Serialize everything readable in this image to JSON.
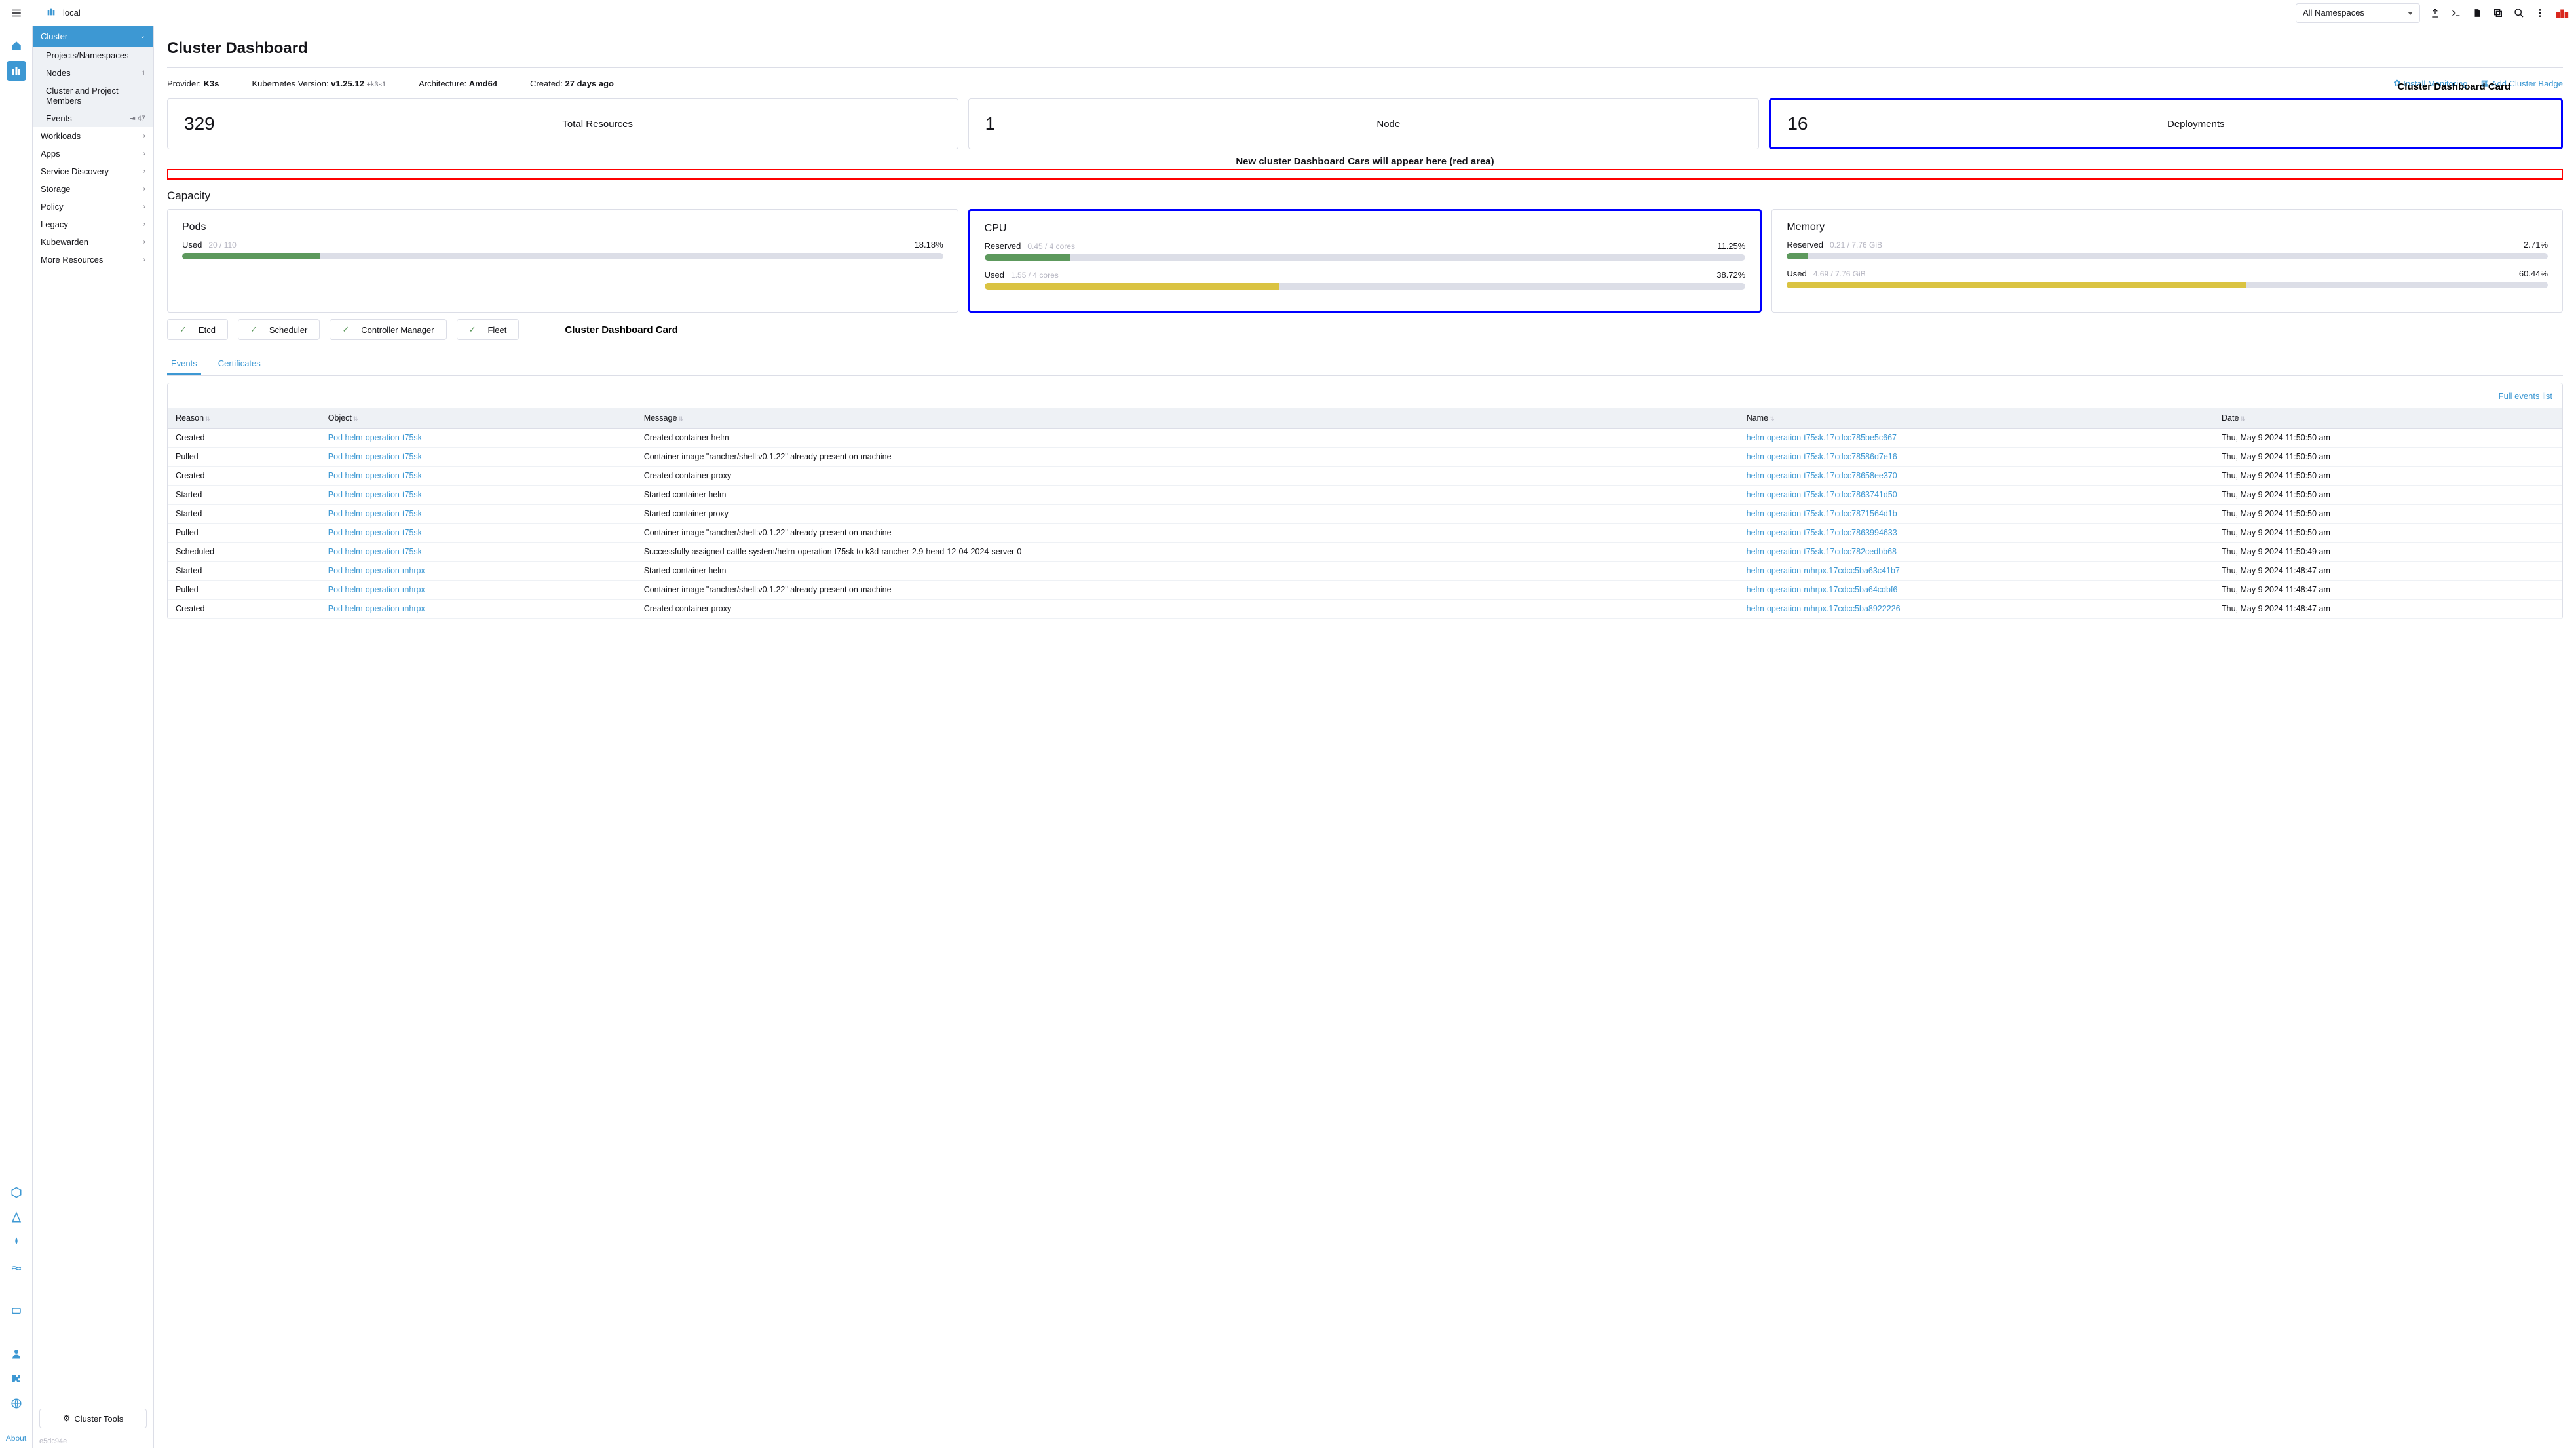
{
  "top": {
    "cluster_name": "local",
    "namespace": "All Namespaces"
  },
  "sidebar": {
    "header": "Cluster",
    "sub": [
      {
        "label": "Projects/Namespaces",
        "badge": ""
      },
      {
        "label": "Nodes",
        "badge": "1"
      },
      {
        "label": "Cluster and Project Members",
        "badge": ""
      },
      {
        "label": "Events",
        "badge": "⇥ 47"
      }
    ],
    "sections": [
      "Workloads",
      "Apps",
      "Service Discovery",
      "Storage",
      "Policy",
      "Legacy",
      "Kubewarden",
      "More Resources"
    ],
    "cluster_tools": "Cluster Tools",
    "version": "e5dc94e",
    "about": "About"
  },
  "page": {
    "title": "Cluster Dashboard",
    "provider_label": "Provider: ",
    "provider_value": "K3s",
    "k8s_label": "Kubernetes Version: ",
    "k8s_value": "v1.25.12",
    "k8s_suffix": "+k3s1",
    "arch_label": "Architecture: ",
    "arch_value": "Amd64",
    "created_label": "Created: ",
    "created_value": "27 days ago",
    "install_monitoring": "Install Monitoring",
    "add_cluster_badge": "Add Cluster Badge"
  },
  "annotations": {
    "card_label": "Cluster Dashboard Card",
    "red_text": "New cluster Dashboard Cars will appear here (red area)",
    "card_label2": "Cluster Dashboard Card"
  },
  "cards": [
    {
      "number": "329",
      "label": "Total Resources"
    },
    {
      "number": "1",
      "label": "Node"
    },
    {
      "number": "16",
      "label": "Deployments"
    }
  ],
  "capacity": {
    "title": "Capacity",
    "pods": {
      "title": "Pods",
      "used_label": "Used",
      "used_detail": "20 / 110",
      "used_pct": "18.18%",
      "used_width": 18.18
    },
    "cpu": {
      "title": "CPU",
      "reserved_label": "Reserved",
      "reserved_detail": "0.45 / 4 cores",
      "reserved_pct": "11.25%",
      "reserved_width": 11.25,
      "used_label": "Used",
      "used_detail": "1.55 / 4 cores",
      "used_pct": "38.72%",
      "used_width": 38.72
    },
    "memory": {
      "title": "Memory",
      "reserved_label": "Reserved",
      "reserved_detail": "0.21 / 7.76 GiB",
      "reserved_pct": "2.71%",
      "reserved_width": 2.71,
      "used_label": "Used",
      "used_detail": "4.69 / 7.76 GiB",
      "used_pct": "60.44%",
      "used_width": 60.44
    }
  },
  "health": [
    "Etcd",
    "Scheduler",
    "Controller Manager",
    "Fleet"
  ],
  "tabs": {
    "events": "Events",
    "certificates": "Certificates",
    "full": "Full events list"
  },
  "events": {
    "columns": [
      "Reason",
      "Object",
      "Message",
      "Name",
      "Date"
    ],
    "rows": [
      {
        "reason": "Created",
        "object": "Pod helm-operation-t75sk",
        "message": "Created container helm",
        "name": "helm-operation-t75sk.17cdcc785be5c667",
        "date": "Thu, May 9 2024  11:50:50 am"
      },
      {
        "reason": "Pulled",
        "object": "Pod helm-operation-t75sk",
        "message": "Container image \"rancher/shell:v0.1.22\" already present on machine",
        "name": "helm-operation-t75sk.17cdcc78586d7e16",
        "date": "Thu, May 9 2024  11:50:50 am"
      },
      {
        "reason": "Created",
        "object": "Pod helm-operation-t75sk",
        "message": "Created container proxy",
        "name": "helm-operation-t75sk.17cdcc78658ee370",
        "date": "Thu, May 9 2024  11:50:50 am"
      },
      {
        "reason": "Started",
        "object": "Pod helm-operation-t75sk",
        "message": "Started container helm",
        "name": "helm-operation-t75sk.17cdcc7863741d50",
        "date": "Thu, May 9 2024  11:50:50 am"
      },
      {
        "reason": "Started",
        "object": "Pod helm-operation-t75sk",
        "message": "Started container proxy",
        "name": "helm-operation-t75sk.17cdcc7871564d1b",
        "date": "Thu, May 9 2024  11:50:50 am"
      },
      {
        "reason": "Pulled",
        "object": "Pod helm-operation-t75sk",
        "message": "Container image \"rancher/shell:v0.1.22\" already present on machine",
        "name": "helm-operation-t75sk.17cdcc7863994633",
        "date": "Thu, May 9 2024  11:50:50 am"
      },
      {
        "reason": "Scheduled",
        "object": "Pod helm-operation-t75sk",
        "message": "Successfully assigned cattle-system/helm-operation-t75sk to k3d-rancher-2.9-head-12-04-2024-server-0",
        "name": "helm-operation-t75sk.17cdcc782cedbb68",
        "date": "Thu, May 9 2024  11:50:49 am"
      },
      {
        "reason": "Started",
        "object": "Pod helm-operation-mhrpx",
        "message": "Started container helm",
        "name": "helm-operation-mhrpx.17cdcc5ba63c41b7",
        "date": "Thu, May 9 2024  11:48:47 am"
      },
      {
        "reason": "Pulled",
        "object": "Pod helm-operation-mhrpx",
        "message": "Container image \"rancher/shell:v0.1.22\" already present on machine",
        "name": "helm-operation-mhrpx.17cdcc5ba64cdbf6",
        "date": "Thu, May 9 2024  11:48:47 am"
      },
      {
        "reason": "Created",
        "object": "Pod helm-operation-mhrpx",
        "message": "Created container proxy",
        "name": "helm-operation-mhrpx.17cdcc5ba8922226",
        "date": "Thu, May 9 2024  11:48:47 am"
      }
    ]
  }
}
